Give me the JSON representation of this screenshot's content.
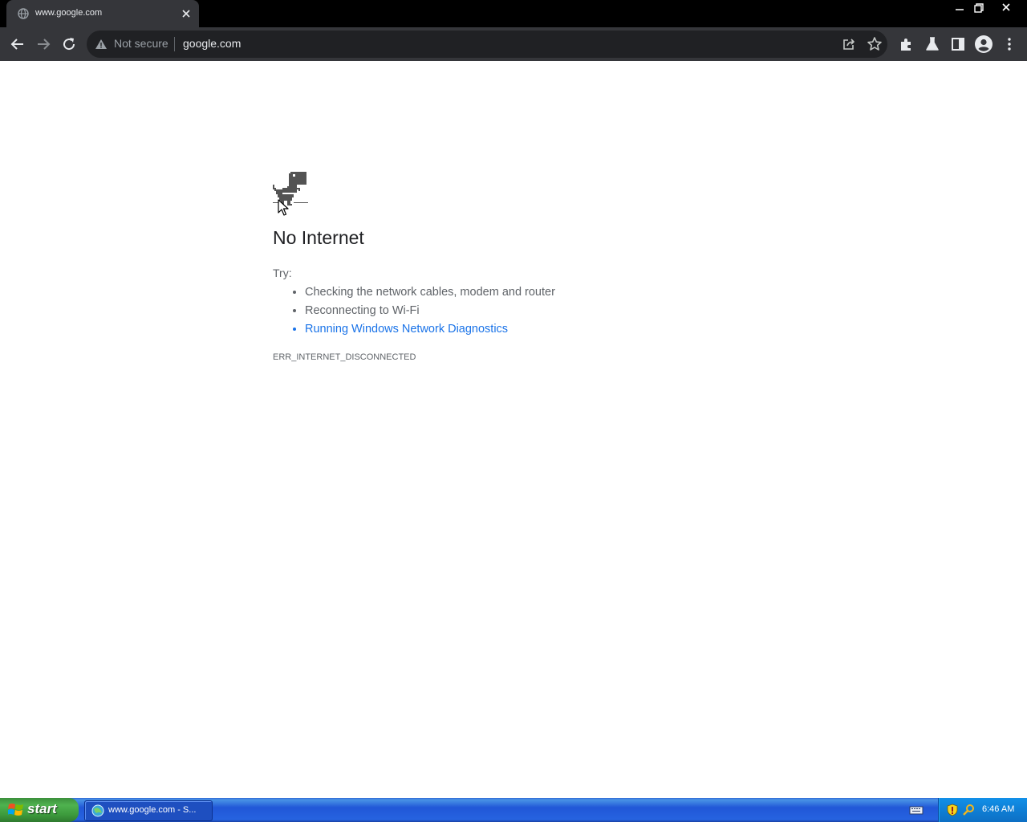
{
  "browser": {
    "tab": {
      "title": "www.google.com",
      "favicon": "globe-icon",
      "close_icon": "close-icon"
    },
    "window_controls": [
      "minimize-icon",
      "restore-icon",
      "close-icon"
    ],
    "nav_icons": [
      "back-arrow-icon",
      "forward-arrow-icon",
      "reload-icon"
    ],
    "omnibox": {
      "security_text": "Not secure",
      "url": "google.com",
      "security_icon": "warning-triangle-icon"
    },
    "toolbar_icons": [
      "share-icon",
      "bookmark-star-icon",
      "extensions-puzzle-icon",
      "labs-flask-icon",
      "side-panel-icon",
      "profile-avatar-icon",
      "more-menu-icon"
    ]
  },
  "page": {
    "heading": "No Internet",
    "try_label": "Try:",
    "suggestions": [
      "Checking the network cables, modem and router",
      "Reconnecting to Wi-Fi",
      "Running Windows Network Diagnostics"
    ],
    "error_code": "ERR_INTERNET_DISCONNECTED",
    "link_color": "#1a73e8"
  },
  "taskbar": {
    "start_label": "start",
    "task_button_label": "www.google.com - S...",
    "clock": "6:46 AM",
    "tray_icons": [
      "security-shield-icon",
      "search-key-icon"
    ]
  }
}
